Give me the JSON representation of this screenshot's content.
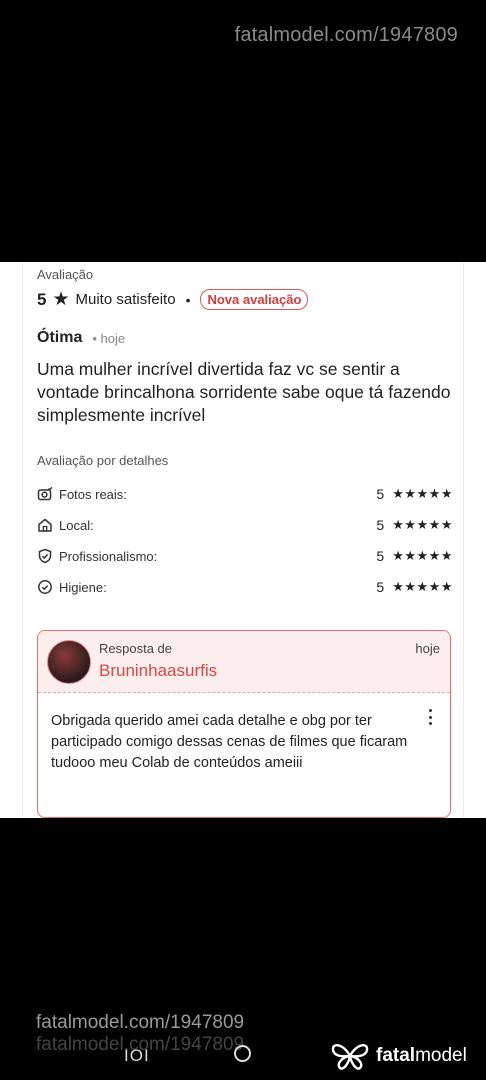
{
  "watermark": {
    "top": "fatalmodel.com/1947809",
    "bottom": "fatalmodel.com/1947809",
    "bottom_echo": "fatalmodel.com/1947809"
  },
  "review": {
    "section_label": "Avaliação",
    "score": "5",
    "score_text": "Muito satisfeito",
    "badge": "Nova avaliação",
    "title": "Ótima",
    "when": "hoje",
    "body": "Uma mulher incrível divertida faz vc se sentir a vontade brincalhona sorridente sabe oque tá fazendo simplesmente incrível",
    "details_label": "Avaliação por detalhes",
    "details": [
      {
        "label": "Fotos reais:",
        "value": "5",
        "stars": "★★★★★",
        "icon": "camera-check-icon"
      },
      {
        "label": "Local:",
        "value": "5",
        "stars": "★★★★★",
        "icon": "home-icon"
      },
      {
        "label": "Profissionalismo:",
        "value": "5",
        "stars": "★★★★★",
        "icon": "shield-check-icon"
      },
      {
        "label": "Higiene:",
        "value": "5",
        "stars": "★★★★★",
        "icon": "check-circle-icon"
      }
    ]
  },
  "reply": {
    "from_label": "Resposta de",
    "name": "Bruninhaasurfis",
    "when": "hoje",
    "text": "Obrigada querido amei cada detalhe e obg por ter participado comigo dessas cenas de filmes que ficaram tudooo meu Colab de conteúdos ameiii"
  },
  "navbar": {
    "recent_glyph": "IOI",
    "brand_prefix": "fatal",
    "brand_suffix": "model"
  },
  "colors": {
    "accent": "#d94848",
    "reply_bg": "#fdeeee"
  }
}
